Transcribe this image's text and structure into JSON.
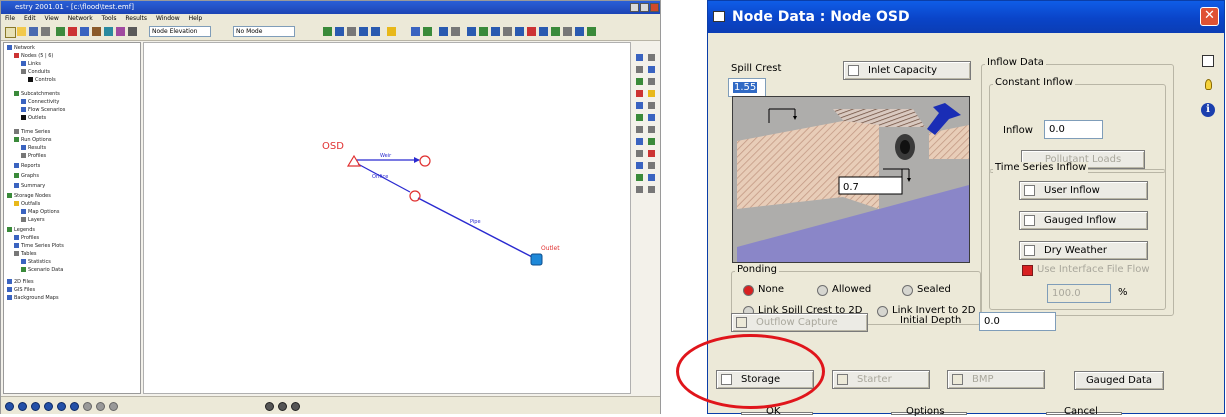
{
  "app": {
    "title": "estry 2001.01 - [c:\\flood\\test.emf]",
    "menu": [
      "File",
      "Edit",
      "View",
      "Network",
      "Tools",
      "Results",
      "Window",
      "Help"
    ],
    "toolbar": {
      "combo1": "Node Elevation",
      "combo2": "No Mode"
    },
    "tree": [
      "Network",
      "Nodes (5 | 6)",
      "Links",
      "Conduits",
      "Controls",
      "Subcatchments",
      "Connectivity",
      "Flow Scenarios",
      "Outlets",
      "Time Series",
      "Run Options",
      "Results",
      "Profiles",
      "Reports",
      "Graphs",
      "Summary",
      "Storage Nodes",
      "Outfalls",
      "Map Options",
      "Layers",
      "Legends",
      "Profiles",
      "Time Series Plots",
      "Tables",
      "Statistics",
      "Scenario Data",
      "2D Files",
      "GIS Files",
      "Background Maps"
    ],
    "canvas": {
      "node_osd_label": "OSD",
      "node_outlet_label": "Outlet",
      "link_weir_label": "Weir",
      "link_orifice_label": "Orifice",
      "link_pipe_label": "Pipe",
      "node_color": "#e03030",
      "link_color": "#2a2ad0",
      "outlet_fill": "#1e88d8"
    }
  },
  "dialog": {
    "title": "Node Data : Node OSD",
    "spill_crest_label": "Spill Crest",
    "spill_crest_value": "1.55",
    "invert_value": "0.7",
    "inlet_capacity_label": "Inlet Capacity",
    "inflow_data_label": "Inflow Data",
    "constant_inflow_label": "Constant Inflow",
    "inflow_label": "Inflow",
    "inflow_value": "0.0",
    "pollutant_loads_label": "Pollutant Loads",
    "time_series_inflow_label": "Time Series Inflow",
    "user_inflow_label": "User Inflow",
    "gauged_inflow_label": "Gauged Inflow",
    "dry_weather_label": "Dry Weather",
    "use_interface_label": "Use Interface File Flow",
    "interface_value": "100.0",
    "percent": "%",
    "ponding_label": "Ponding",
    "ponding_none": "None",
    "ponding_allowed": "Allowed",
    "ponding_sealed": "Sealed",
    "link_spill_label": "Link Spill Crest to 2D",
    "link_invert_label": "Link Invert to 2D",
    "outflow_capture_label": "Outflow Capture",
    "initial_depth_label": "Initial Depth",
    "initial_depth_value": "0.0",
    "storage_label": "Storage",
    "starter_label": "Starter",
    "bmp_label": "BMP",
    "gauged_data_label": "Gauged Data",
    "ok_label": "OK",
    "options_label": "Options",
    "cancel_label": "Cancel",
    "close_glyph": "✕",
    "side_icons": [
      "copy-icon",
      "lightbulb-icon",
      "info-icon"
    ],
    "info_glyph": "i"
  },
  "annotation": {
    "highlight_color": "#e0151b"
  }
}
